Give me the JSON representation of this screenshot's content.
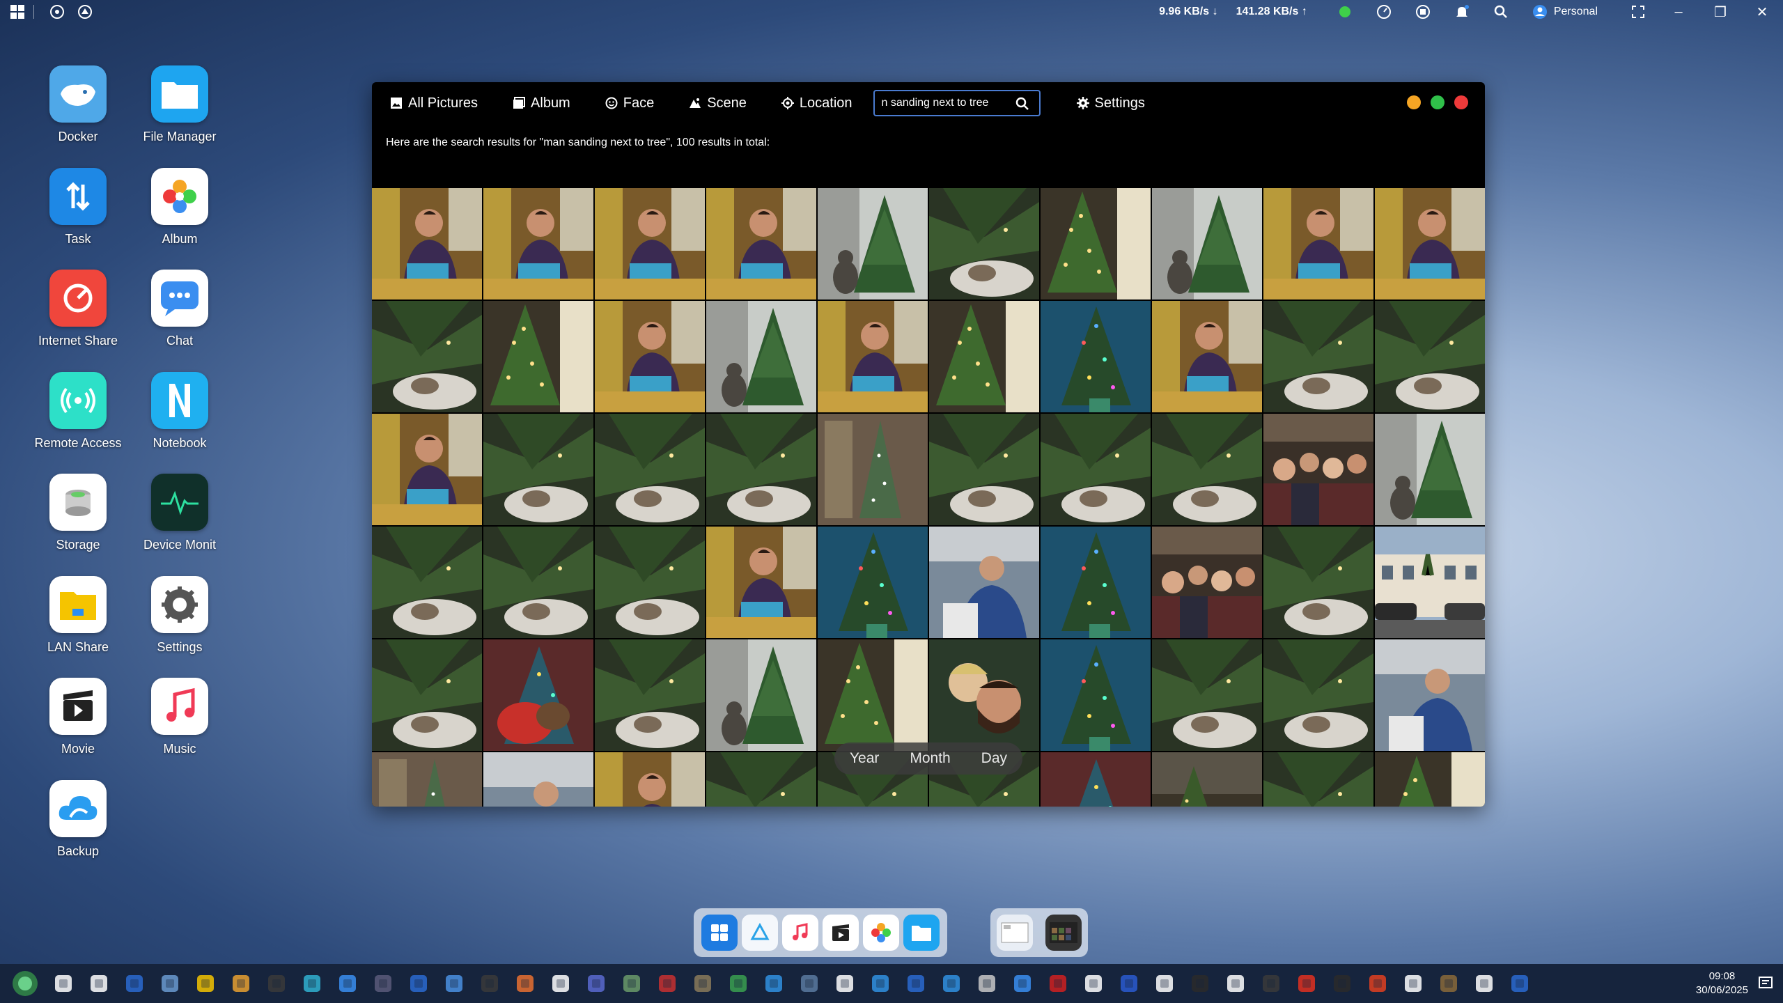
{
  "topbar": {
    "download_speed": "9.96 KB/s ↓",
    "upload_speed": "141.28 KB/s ↑",
    "user": "Personal"
  },
  "desktop_icons": [
    {
      "label": "Docker",
      "color": "#4fa8e8"
    },
    {
      "label": "File Manager",
      "color": "#1ea5f0"
    },
    {
      "label": "Task",
      "color": "#1e88e5"
    },
    {
      "label": "Album",
      "color": "#ffffff"
    },
    {
      "label": "Internet Share",
      "color": "#f0463c"
    },
    {
      "label": "Chat",
      "color": "#ffffff"
    },
    {
      "label": "Remote Access",
      "color": "#2de0c8"
    },
    {
      "label": "Notebook",
      "color": "#1fb0f0"
    },
    {
      "label": "Storage",
      "color": "#ffffff"
    },
    {
      "label": "Device Monit",
      "color": "#10302a"
    },
    {
      "label": "LAN Share",
      "color": "#ffffff"
    },
    {
      "label": "Settings",
      "color": "#ffffff"
    },
    {
      "label": "Movie",
      "color": "#ffffff"
    },
    {
      "label": "Music",
      "color": "#ffffff"
    },
    {
      "label": "Backup",
      "color": "#ffffff"
    }
  ],
  "app": {
    "tabs": [
      {
        "label": "All Pictures",
        "icon": "image-icon"
      },
      {
        "label": "Album",
        "icon": "album-icon"
      },
      {
        "label": "Face",
        "icon": "face-icon"
      },
      {
        "label": "Scene",
        "icon": "scene-icon"
      },
      {
        "label": "Location",
        "icon": "location-icon"
      }
    ],
    "search_value": "n sanding next to tree",
    "settings_label": "Settings",
    "result_message": "Here are the search results for \"man sanding next to tree\",  100 results in total:",
    "date_options": [
      "Year",
      "Month",
      "Day"
    ],
    "photo_types": [
      "man",
      "man",
      "man",
      "man",
      "tree-cat",
      "tree-dark",
      "tree-lit",
      "tree-cat",
      "man",
      "man",
      "tree-dark",
      "tree-lit",
      "man",
      "tree-cat",
      "man",
      "tree-lit",
      "tree-blue",
      "man",
      "tree-dark",
      "tree-dark",
      "man",
      "tree-dark",
      "tree-dark",
      "tree-dark",
      "tree-room",
      "tree-dark",
      "tree-dark",
      "tree-dark",
      "group",
      "tree-cat",
      "tree-dark",
      "tree-dark",
      "tree-dark",
      "man",
      "tree-blue",
      "person",
      "tree-blue",
      "group",
      "tree-dark",
      "building",
      "tree-dark",
      "tree-red",
      "tree-dark",
      "tree-cat",
      "tree-lit",
      "selfie",
      "tree-blue",
      "tree-dark",
      "tree-dark",
      "person",
      "tree-room",
      "person",
      "man",
      "tree-dark",
      "tree-dark",
      "tree-dark",
      "tree-red",
      "room",
      "tree-dark",
      "tree-lit"
    ]
  },
  "taskbar": {
    "time": "09:08",
    "date": "30/06/2025"
  }
}
